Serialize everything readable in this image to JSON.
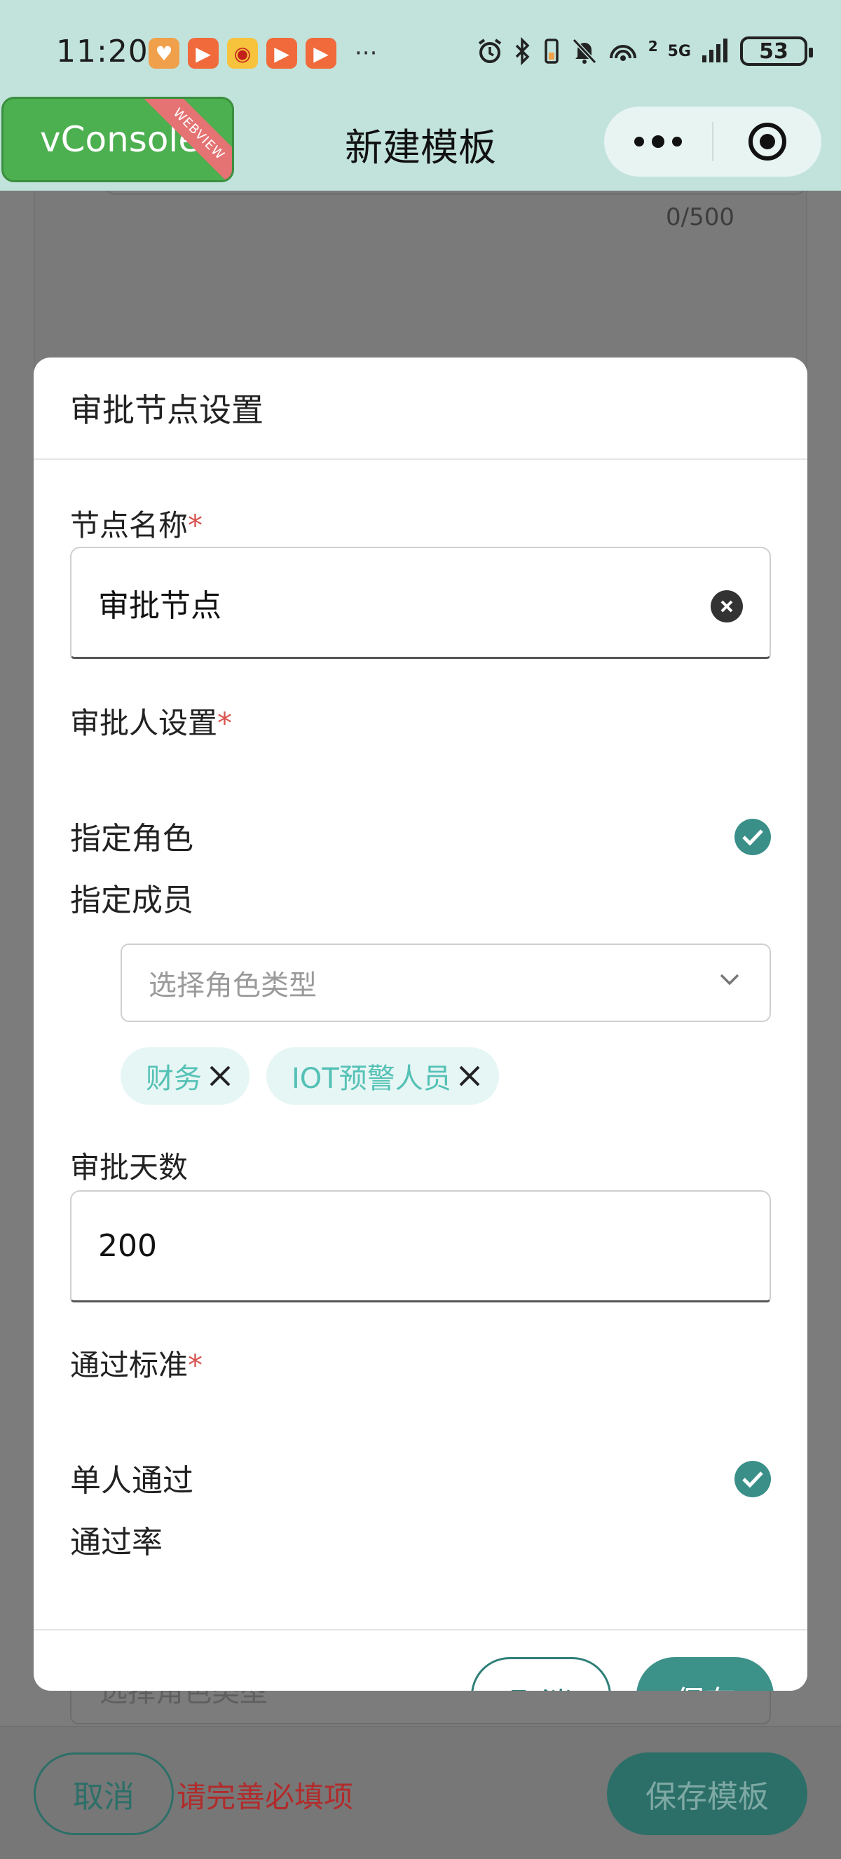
{
  "status_bar": {
    "time": "11:20",
    "more_dots": "···",
    "signal_label": "5G",
    "signal_sup": "2",
    "battery": "53"
  },
  "header": {
    "vconsole_label": "vConsole",
    "vconsole_ribbon": "WEBVIEW",
    "title": "新建模板",
    "more_icon": "more-dots-icon",
    "close_icon": "target-circle-icon"
  },
  "background": {
    "char_count": "0/500",
    "select_placeholder": "选择角色类型",
    "cancel_label": "取消",
    "warning": "请完善必填项",
    "save_label": "保存模板"
  },
  "modal": {
    "title": "审批节点设置",
    "node_name_label": "节点名称",
    "required_mark": "*",
    "node_name_value": "审批节点",
    "approver_label": "审批人设置",
    "approver_options": [
      {
        "label": "指定角色",
        "checked": true
      },
      {
        "label": "指定成员",
        "checked": false
      }
    ],
    "role_select_placeholder": "选择角色类型",
    "tags": [
      "财务",
      "IOT预警人员"
    ],
    "days_label": "审批天数",
    "days_value": "200",
    "pass_label": "通过标准",
    "pass_options": [
      {
        "label": "单人通过",
        "checked": true
      },
      {
        "label": "通过率",
        "checked": false
      }
    ],
    "cancel_label": "取消",
    "save_label": "保存"
  },
  "colors": {
    "header_bg": "#c2e3dc",
    "accent": "#3a8f88",
    "tag_bg": "#e6f6f4",
    "tag_text": "#55c1b6",
    "required": "#d9534f",
    "vconsole": "#4caf50"
  }
}
